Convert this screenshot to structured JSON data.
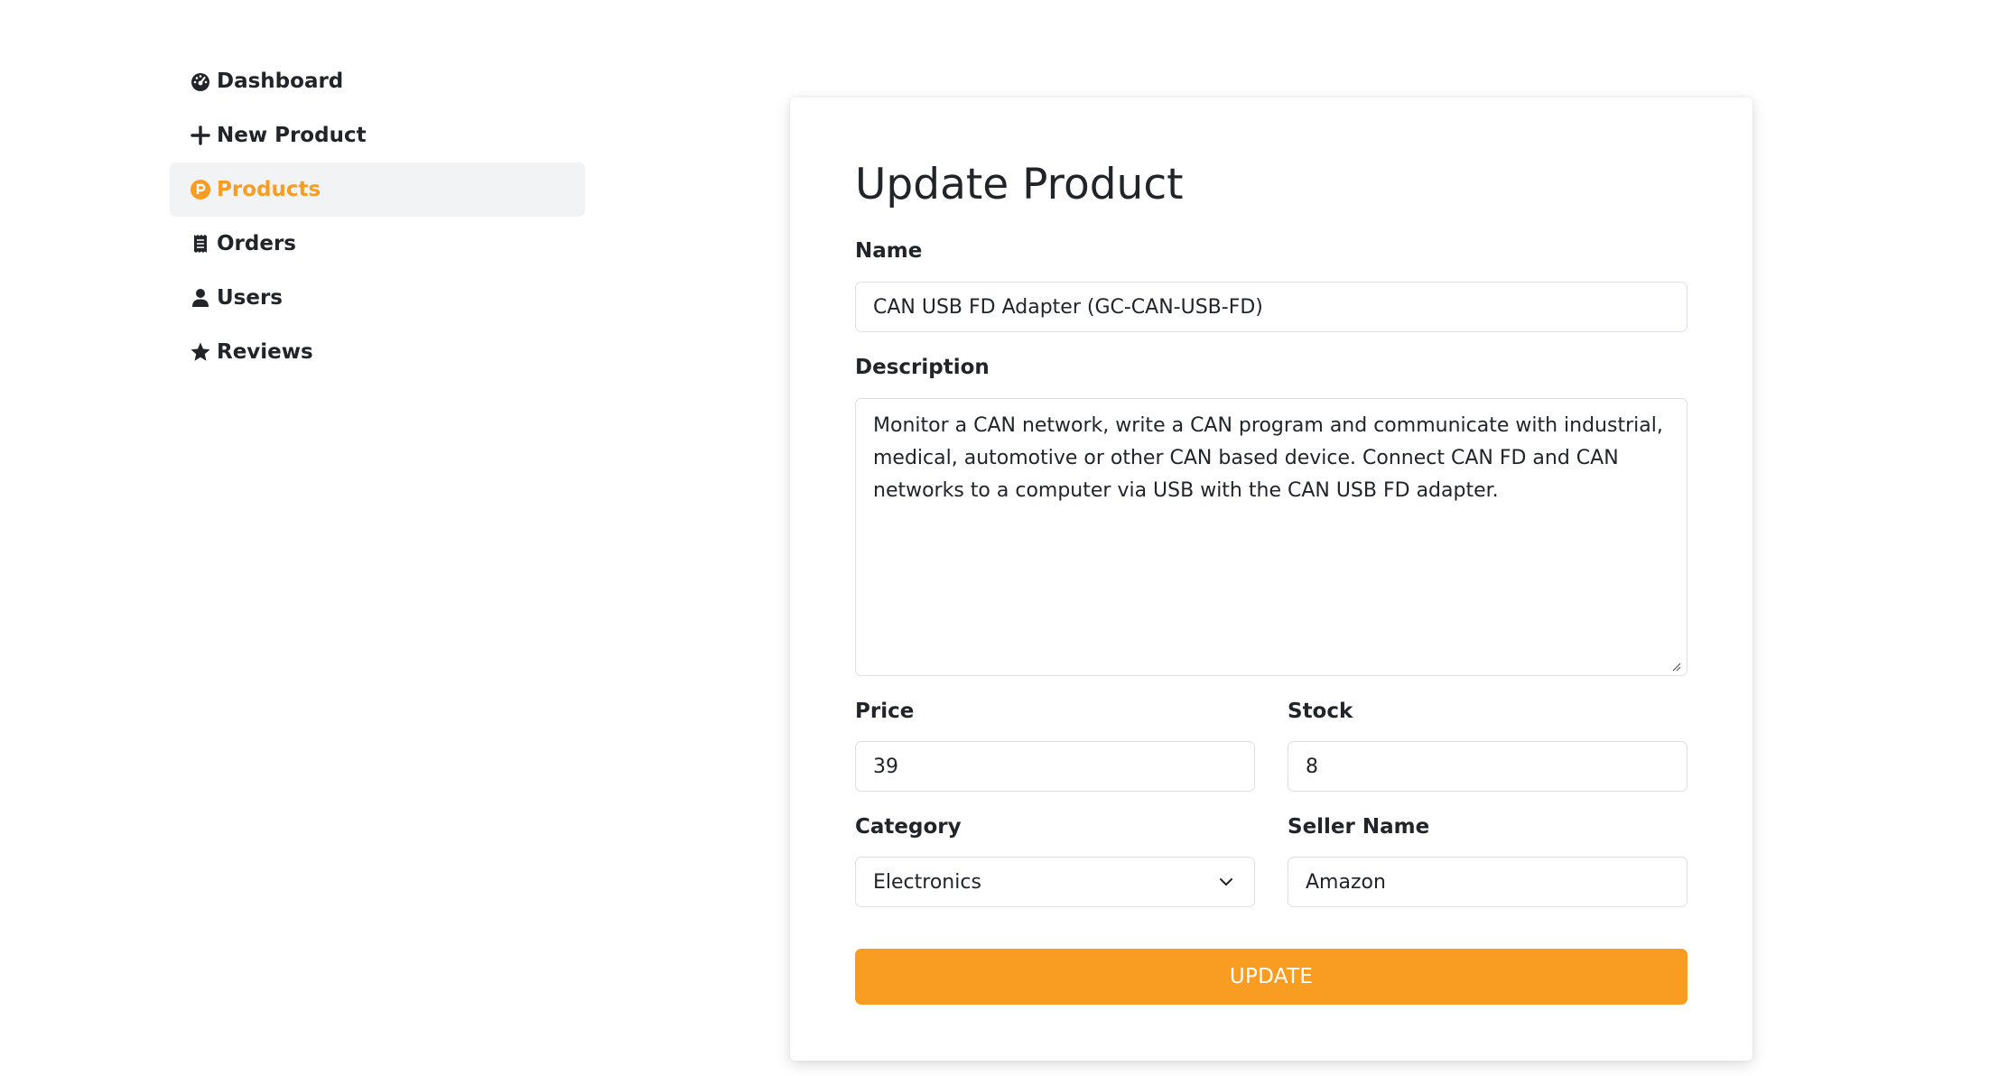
{
  "sidebar": {
    "items": [
      {
        "label": "Dashboard",
        "icon": "dashboard-gauge-icon"
      },
      {
        "label": "New Product",
        "icon": "plus-icon"
      },
      {
        "label": "Products",
        "icon": "product-p-icon",
        "active": true
      },
      {
        "label": "Orders",
        "icon": "receipt-icon"
      },
      {
        "label": "Users",
        "icon": "user-icon"
      },
      {
        "label": "Reviews",
        "icon": "star-icon"
      }
    ]
  },
  "form": {
    "title": "Update Product",
    "name_label": "Name",
    "name_value": "CAN USB FD Adapter (GC-CAN-USB-FD)",
    "description_label": "Description",
    "description_value": "Monitor a CAN network, write a CAN program and communicate with industrial, medical, automotive or other CAN based device. Connect CAN FD and CAN networks to a computer via USB with the CAN USB FD adapter.",
    "price_label": "Price",
    "price_value": "39",
    "stock_label": "Stock",
    "stock_value": "8",
    "category_label": "Category",
    "category_value": "Electronics",
    "seller_label": "Seller Name",
    "seller_value": "Amazon",
    "submit_label": "UPDATE"
  },
  "colors": {
    "accent": "#f89d22",
    "active_bg": "#f2f3f5",
    "text": "#212529"
  }
}
